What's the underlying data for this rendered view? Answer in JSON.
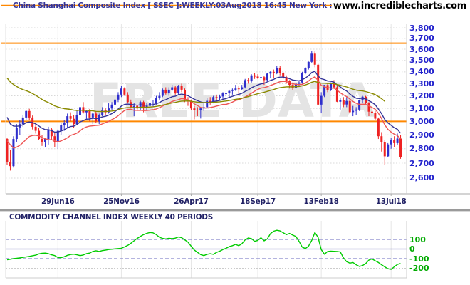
{
  "header": {
    "title": "China Shanghai Composite Index [ SSEC ]:WEEKLY:03Aug2018 16:45 New York : Data Del..",
    "site": "www.incrediblecharts.com"
  },
  "watermark": "FREE DATA",
  "colors": {
    "title": "#333399",
    "url": "#000000",
    "watermark": "#e4e4e4",
    "price_label": "#2222cc",
    "date_label": "#222266",
    "cci_label": "#00aa00",
    "candle_up": "#2e2ecc",
    "candle_down": "#ee2222",
    "ma_fast": "#333399",
    "ma_low": "#ee5555",
    "ma_slow": "#8a8a00",
    "trendline": "#ff8800",
    "cci_line": "#00cc00",
    "grid_h": "#d8d8d8",
    "grid_v": "#e6e6e6",
    "guide_dashed": "#8888cc",
    "guide_zero": "#7070b8",
    "guide_extreme": "#cccccc",
    "axis": "#aaaaaa"
  },
  "price_axis": {
    "labels": [
      {
        "text": "3,800",
        "value": 3800
      },
      {
        "text": "3,700",
        "value": 3700
      },
      {
        "text": "3,600",
        "value": 3600
      },
      {
        "text": "3,500",
        "value": 3500
      },
      {
        "text": "3,400",
        "value": 3400
      },
      {
        "text": "3,300",
        "value": 3300
      },
      {
        "text": "3,200",
        "value": 3200
      },
      {
        "text": "3,100",
        "value": 3100
      },
      {
        "text": "3,000",
        "value": 3000
      },
      {
        "text": "2,900",
        "value": 2900
      },
      {
        "text": "2,800",
        "value": 2800
      },
      {
        "text": "2,700",
        "value": 2700
      },
      {
        "text": "2,600",
        "value": 2600
      }
    ]
  },
  "date_axis": [
    {
      "label": "29Jun16",
      "index": 16
    },
    {
      "label": "25Nov16",
      "index": 36
    },
    {
      "label": "26Apr17",
      "index": 58
    },
    {
      "label": "18Sep17",
      "index": 79
    },
    {
      "label": "13Feb18",
      "index": 99
    },
    {
      "label": "13Jul18",
      "index": 121
    }
  ],
  "indicator": {
    "title": "COMMODITY CHANNEL INDEX WEEKLY 40 PERIODS",
    "axis_labels": [
      {
        "text": "100",
        "value": 100
      },
      {
        "text": "0",
        "value": 0
      },
      {
        "text": "-100",
        "value": -100
      },
      {
        "text": "-200",
        "value": -200
      }
    ],
    "guides": {
      "upper": 100,
      "zero": 0,
      "lower": -100,
      "extreme": -200
    }
  },
  "chart_data": {
    "type": "candlestick",
    "instrument": "China Shanghai Composite Index [ SSEC ]",
    "interval": "WEEKLY",
    "as_of": "03Aug2018 16:45 New York",
    "y_axis_range": [
      2600,
      3800
    ],
    "y_scale": "log",
    "horizontal_lines": [
      4020,
      3655,
      3000
    ],
    "moving_averages": [
      {
        "name": "fast-ema-close",
        "color_key": "ma_fast",
        "field": 3,
        "period": 13,
        "seed": 3085,
        "end": 125
      },
      {
        "name": "ema-low",
        "color_key": "ma_low",
        "field": 2,
        "period": 13,
        "seed": 2885,
        "end": 125
      },
      {
        "name": "slow-ema-close",
        "color_key": "ma_slow",
        "field": 3,
        "period": 40,
        "seed": 3380,
        "end": 120
      }
    ],
    "candles_ohlc": [
      [
        2870,
        2880,
        2690,
        2710
      ],
      [
        2710,
        2790,
        2650,
        2680
      ],
      [
        2680,
        2890,
        2670,
        2870
      ],
      [
        2870,
        2980,
        2850,
        2955
      ],
      [
        2955,
        3010,
        2900,
        2980
      ],
      [
        2980,
        3050,
        2960,
        3030
      ],
      [
        3030,
        3090,
        3010,
        3080
      ],
      [
        3080,
        3097,
        3010,
        3030
      ],
      [
        3030,
        3045,
        2940,
        2960
      ],
      [
        2960,
        2990,
        2910,
        2930
      ],
      [
        2930,
        2950,
        2860,
        2870
      ],
      [
        2870,
        2900,
        2820,
        2850
      ],
      [
        2850,
        2880,
        2810,
        2870
      ],
      [
        2870,
        2960,
        2830,
        2940
      ],
      [
        2940,
        2950,
        2860,
        2890
      ],
      [
        2890,
        2920,
        2810,
        2850
      ],
      [
        2850,
        2940,
        2800,
        2930
      ],
      [
        2930,
        2990,
        2900,
        2970
      ],
      [
        2970,
        3010,
        2930,
        2990
      ],
      [
        2990,
        3060,
        2950,
        3040
      ],
      [
        3040,
        3070,
        3000,
        3020
      ],
      [
        3020,
        3050,
        2950,
        2980
      ],
      [
        2980,
        3090,
        2970,
        3050
      ],
      [
        3050,
        3140,
        3030,
        3110
      ],
      [
        3110,
        3150,
        3060,
        3070
      ],
      [
        3070,
        3090,
        3020,
        3080
      ],
      [
        3080,
        3095,
        3000,
        3030
      ],
      [
        3030,
        3070,
        2980,
        3060
      ],
      [
        3060,
        3080,
        2990,
        3000
      ],
      [
        3000,
        3060,
        2980,
        3050
      ],
      [
        3050,
        3110,
        3040,
        3090
      ],
      [
        3090,
        3100,
        3050,
        3070
      ],
      [
        3070,
        3140,
        3060,
        3100
      ],
      [
        3100,
        3150,
        3090,
        3130
      ],
      [
        3130,
        3190,
        3100,
        3170
      ],
      [
        3170,
        3230,
        3150,
        3210
      ],
      [
        3210,
        3280,
        3190,
        3260
      ],
      [
        3260,
        3270,
        3200,
        3210
      ],
      [
        3210,
        3230,
        3140,
        3150
      ],
      [
        3150,
        3170,
        3100,
        3110
      ],
      [
        3110,
        3140,
        3040,
        3120
      ],
      [
        3120,
        3130,
        3080,
        3100
      ],
      [
        3100,
        3160,
        3090,
        3150
      ],
      [
        3150,
        3160,
        3070,
        3110
      ],
      [
        3110,
        3140,
        3090,
        3120
      ],
      [
        3120,
        3160,
        3100,
        3140
      ],
      [
        3140,
        3165,
        3110,
        3145
      ],
      [
        3145,
        3200,
        3130,
        3180
      ],
      [
        3180,
        3230,
        3170,
        3200
      ],
      [
        3200,
        3260,
        3190,
        3250
      ],
      [
        3250,
        3270,
        3210,
        3220
      ],
      [
        3220,
        3270,
        3200,
        3250
      ],
      [
        3250,
        3290,
        3240,
        3270
      ],
      [
        3270,
        3280,
        3210,
        3220
      ],
      [
        3220,
        3290,
        3210,
        3280
      ],
      [
        3280,
        3300,
        3230,
        3250
      ],
      [
        3250,
        3260,
        3150,
        3170
      ],
      [
        3170,
        3190,
        3120,
        3160
      ],
      [
        3160,
        3170,
        3090,
        3100
      ],
      [
        3100,
        3120,
        3016,
        3090
      ],
      [
        3090,
        3110,
        3040,
        3085
      ],
      [
        3085,
        3110,
        3022,
        3100
      ],
      [
        3100,
        3140,
        3080,
        3110
      ],
      [
        3110,
        3180,
        3100,
        3160
      ],
      [
        3160,
        3190,
        3130,
        3150
      ],
      [
        3150,
        3200,
        3140,
        3190
      ],
      [
        3190,
        3210,
        3160,
        3185
      ],
      [
        3185,
        3210,
        3165,
        3195
      ],
      [
        3195,
        3230,
        3170,
        3220
      ],
      [
        3220,
        3240,
        3130,
        3220
      ],
      [
        3220,
        3250,
        3190,
        3240
      ],
      [
        3240,
        3260,
        3210,
        3250
      ],
      [
        3250,
        3290,
        3240,
        3260
      ],
      [
        3260,
        3280,
        3200,
        3255
      ],
      [
        3255,
        3290,
        3245,
        3270
      ],
      [
        3270,
        3340,
        3260,
        3330
      ],
      [
        3330,
        3350,
        3300,
        3320
      ],
      [
        3320,
        3380,
        3310,
        3370
      ],
      [
        3370,
        3390,
        3340,
        3360
      ],
      [
        3360,
        3380,
        3340,
        3350
      ],
      [
        3350,
        3390,
        3330,
        3355
      ],
      [
        3355,
        3365,
        3290,
        3330
      ],
      [
        3330,
        3390,
        3320,
        3385
      ],
      [
        3385,
        3410,
        3350,
        3400
      ],
      [
        3400,
        3420,
        3350,
        3390
      ],
      [
        3390,
        3450,
        3380,
        3430
      ],
      [
        3430,
        3450,
        3370,
        3390
      ],
      [
        3390,
        3400,
        3340,
        3355
      ],
      [
        3355,
        3370,
        3300,
        3320
      ],
      [
        3320,
        3330,
        3260,
        3290
      ],
      [
        3290,
        3310,
        3250,
        3266
      ],
      [
        3266,
        3310,
        3260,
        3300
      ],
      [
        3300,
        3320,
        3280,
        3310
      ],
      [
        3310,
        3400,
        3300,
        3390
      ],
      [
        3390,
        3440,
        3380,
        3430
      ],
      [
        3430,
        3490,
        3420,
        3487
      ],
      [
        3487,
        3587,
        3480,
        3560
      ],
      [
        3560,
        3580,
        3440,
        3462
      ],
      [
        3462,
        3470,
        3125,
        3130
      ],
      [
        3130,
        3230,
        3062,
        3200
      ],
      [
        3200,
        3290,
        3190,
        3289
      ],
      [
        3289,
        3300,
        3230,
        3250
      ],
      [
        3250,
        3310,
        3240,
        3307
      ],
      [
        3307,
        3330,
        3260,
        3270
      ],
      [
        3270,
        3280,
        3150,
        3153
      ],
      [
        3153,
        3180,
        3091,
        3168
      ],
      [
        3168,
        3190,
        3110,
        3131
      ],
      [
        3131,
        3190,
        3110,
        3159
      ],
      [
        3159,
        3170,
        3060,
        3071
      ],
      [
        3071,
        3120,
        3040,
        3082
      ],
      [
        3082,
        3110,
        3050,
        3091
      ],
      [
        3091,
        3170,
        3080,
        3163
      ],
      [
        3163,
        3200,
        3140,
        3193
      ],
      [
        3193,
        3200,
        3130,
        3141
      ],
      [
        3141,
        3150,
        3040,
        3075
      ],
      [
        3075,
        3120,
        3040,
        3067
      ],
      [
        3067,
        3080,
        3010,
        3021
      ],
      [
        3021,
        3030,
        2870,
        2890
      ],
      [
        2890,
        2920,
        2780,
        2847
      ],
      [
        2847,
        2860,
        2690,
        2747
      ],
      [
        2747,
        2840,
        2740,
        2831
      ],
      [
        2831,
        2880,
        2800,
        2865
      ],
      [
        2865,
        2890,
        2810,
        2840
      ],
      [
        2840,
        2910,
        2830,
        2873
      ],
      [
        2873,
        2900,
        2730,
        2740
      ]
    ],
    "cci_values": [
      -112,
      -106,
      -100,
      -96,
      -92,
      -87,
      -82,
      -76,
      -70,
      -64,
      -50,
      -44,
      -42,
      -48,
      -60,
      -68,
      -88,
      -90,
      -80,
      -65,
      -57,
      -53,
      -60,
      -68,
      -62,
      -48,
      -42,
      -25,
      -18,
      -25,
      -16,
      -12,
      -5,
      -2,
      2,
      5,
      8,
      22,
      38,
      60,
      85,
      110,
      132,
      150,
      163,
      172,
      168,
      150,
      122,
      110,
      105,
      112,
      108,
      113,
      125,
      118,
      95,
      72,
      30,
      -10,
      -35,
      -58,
      -68,
      -55,
      -48,
      -55,
      -35,
      -22,
      -5,
      8,
      25,
      35,
      48,
      35,
      55,
      95,
      115,
      108,
      80,
      90,
      118,
      85,
      105,
      160,
      185,
      195,
      188,
      170,
      150,
      162,
      145,
      130,
      80,
      20,
      5,
      30,
      90,
      172,
      120,
      -5,
      -54,
      -25,
      -22,
      -24,
      -25,
      -30,
      -91,
      -132,
      -147,
      -140,
      -164,
      -181,
      -172,
      -152,
      -115,
      -103,
      -122,
      -140,
      -164,
      -185,
      -205,
      -212,
      -185,
      -160,
      -150
    ]
  }
}
